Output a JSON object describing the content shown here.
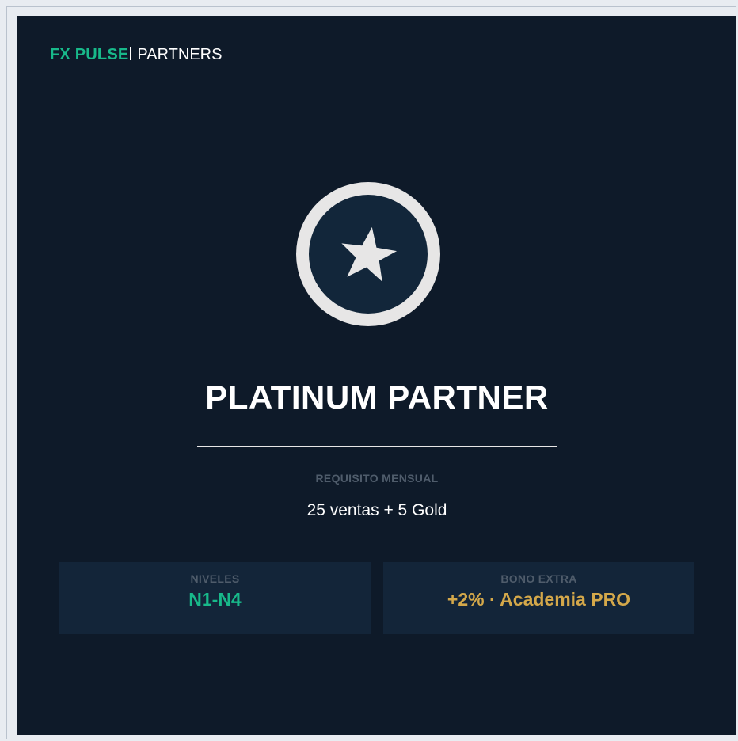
{
  "brand": {
    "name": "FX PULSE",
    "suffix": "PARTNERS"
  },
  "badge": {
    "icon": "star-icon"
  },
  "tier": {
    "title": "PLATINUM PARTNER"
  },
  "requirement": {
    "label": "REQUISITO MENSUAL",
    "value": "25 ventas + 5 Gold"
  },
  "stats": {
    "levels": {
      "label": "NIVELES",
      "value": "N1-N4"
    },
    "bonus": {
      "label": "BONO EXTRA",
      "value": "+2% · Academia PRO"
    }
  },
  "colors": {
    "background": "#0e1a29",
    "panel": "#132539",
    "accent_green": "#18b98a",
    "accent_gold": "#d4a84a",
    "badge_ring": "#e7e6e6",
    "muted_label": "#4f5c6b"
  }
}
